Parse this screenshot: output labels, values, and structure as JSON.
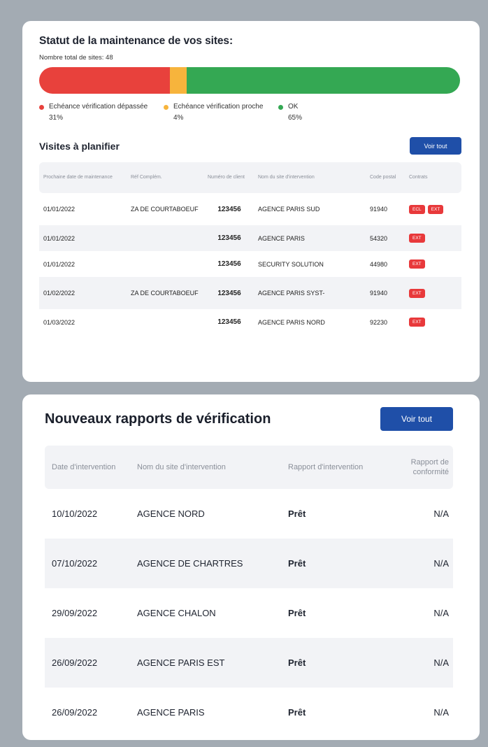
{
  "maintenance": {
    "title": "Statut de la maintenance de vos sites:",
    "total_sites": "Nombre total de sites: 48",
    "status_bar": [
      {
        "color": "#e8413c",
        "fraction": 0.31
      },
      {
        "color": "#f7b43c",
        "fraction": 0.04
      },
      {
        "color": "#34a853",
        "fraction": 0.65
      }
    ],
    "legend": [
      {
        "label": "Echéance vérification dépassée",
        "pct": "31%",
        "color": "#e8413c"
      },
      {
        "label": "Echéance vérification proche",
        "pct": "4%",
        "color": "#f7b43c"
      },
      {
        "label": "OK",
        "pct": "65%",
        "color": "#34a853"
      }
    ]
  },
  "visits": {
    "title": "Visites à planifier",
    "see_all": "Voir tout",
    "headers": [
      "Prochaine date de maintenance",
      "Réf Complém.",
      "Numéro de client",
      "Nom du site d'intervention",
      "Code postal",
      "Contrats"
    ],
    "rows": [
      {
        "date": "01/01/2022",
        "ref": "ZA DE COURTABOEUF",
        "client": "123456",
        "site": "AGENCE PARIS SUD",
        "postal": "91940",
        "contracts": [
          "ECL",
          "EXT"
        ]
      },
      {
        "date": "01/01/2022",
        "ref": "",
        "client": "123456",
        "site": "AGENCE PARIS",
        "postal": "54320",
        "contracts": [
          "EXT"
        ]
      },
      {
        "date": "01/01/2022",
        "ref": "",
        "client": "123456",
        "site": "SECURITY  SOLUTION",
        "postal": "44980",
        "contracts": [
          "EXT"
        ]
      },
      {
        "date": "01/02/2022",
        "ref": "ZA DE COURTABOEUF",
        "client": "123456",
        "site": "AGENCE PARIS SYST-",
        "postal": "91940",
        "contracts": [
          "EXT"
        ]
      },
      {
        "date": "01/03/2022",
        "ref": "",
        "client": "123456",
        "site": "AGENCE PARIS NORD",
        "postal": "92230",
        "contracts": [
          "EXT"
        ]
      }
    ]
  },
  "reports": {
    "title": "Nouveaux rapports de vérification",
    "see_all": "Voir tout",
    "headers": [
      "Date d'intervention",
      "Nom du site d'intervention",
      "Rapport d'intervention",
      "Rapport de conformité"
    ],
    "rows": [
      {
        "date": "10/10/2022",
        "site": "AGENCE  NORD",
        "report": "Prêt",
        "conformity": "N/A"
      },
      {
        "date": "07/10/2022",
        "site": "AGENCE DE  CHARTRES",
        "report": "Prêt",
        "conformity": "N/A"
      },
      {
        "date": "29/09/2022",
        "site": "AGENCE CHALON",
        "report": "Prêt",
        "conformity": "N/A"
      },
      {
        "date": "26/09/2022",
        "site": "AGENCE PARIS EST",
        "report": "Prêt",
        "conformity": "N/A"
      },
      {
        "date": "26/09/2022",
        "site": "AGENCE PARIS",
        "report": "Prêt",
        "conformity": "N/A"
      }
    ]
  }
}
